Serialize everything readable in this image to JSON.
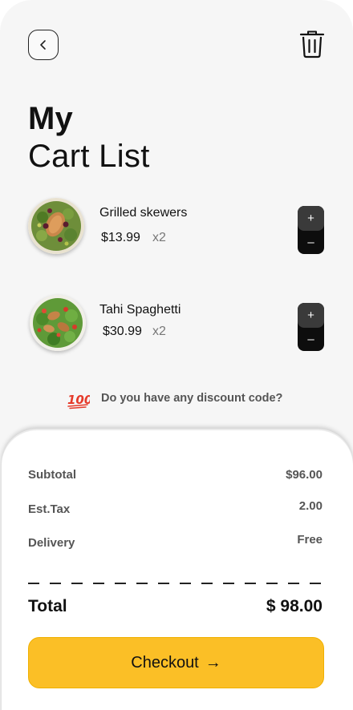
{
  "header": {
    "back_icon": "chevron-left-icon",
    "trash_icon": "trash-icon",
    "title_line1": "My",
    "title_line2": "Cart List"
  },
  "cart": {
    "items": [
      {
        "name": "Grilled skewers",
        "price": "$13.99",
        "quantity": "x2",
        "image": "salad-dish-image",
        "plus": "+",
        "minus": "–"
      },
      {
        "name": "Tahi Spaghetti",
        "price": "$30.99",
        "quantity": "x2",
        "image": "salad-dish-image",
        "plus": "+",
        "minus": "–"
      }
    ]
  },
  "discount": {
    "icon": "hundred-points-icon",
    "icon_text": "100",
    "text": "Do you have any discount code?"
  },
  "summary": {
    "subtotal_label": "Subtotal",
    "subtotal_value": "$96.00",
    "tax_label": "Est.Tax",
    "tax_value": "2.00",
    "delivery_label": "Delivery",
    "delivery_value": "Free",
    "total_label": "Total",
    "total_value": "$ 98.00"
  },
  "checkout": {
    "label": "Checkout",
    "arrow": "→"
  },
  "colors": {
    "accent": "#fbbf26",
    "background": "#f6f6f6",
    "stepper": "#0d0d0d"
  }
}
